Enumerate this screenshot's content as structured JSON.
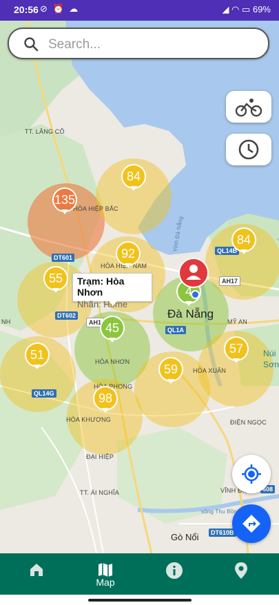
{
  "status_bar": {
    "time": "20:56",
    "battery": "69%"
  },
  "search": {
    "placeholder": "Search..."
  },
  "colors": {
    "status_bar": "#4e2fb5",
    "nav_bar": "#006f5a",
    "good_green": "#8cc63e",
    "moderate_yellow": "#f2c21c",
    "unhealthy_orange": "#ec7a42",
    "fab_blue": "#1463f6"
  },
  "stations": [
    {
      "value": "135",
      "level": "orange"
    },
    {
      "value": "84",
      "level": "yellow"
    },
    {
      "value": "92",
      "level": "yellow"
    },
    {
      "value": "55",
      "level": "yellow"
    },
    {
      "value": "84",
      "level": "yellow"
    },
    {
      "value": "4",
      "level": "green"
    },
    {
      "value": "45",
      "level": "green"
    },
    {
      "value": "51",
      "level": "yellow"
    },
    {
      "value": "59",
      "level": "yellow"
    },
    {
      "value": "57",
      "level": "yellow"
    },
    {
      "value": "98",
      "level": "yellow"
    }
  ],
  "tooltip": {
    "station": "Trạm: Hòa Nhơn",
    "label": "Nhãn: Home"
  },
  "map_labels": {
    "lang_co": "TT. LĂNG CÔ",
    "hoa_hiep_bac": "HÒA HIỆP BẮC",
    "hoa_hiep_nam": "HÒA HIỆP NAM",
    "nh": "NH",
    "hoa_nhon": "HÒA NHƠN",
    "hoa_phong": "HÒA PHONG",
    "hoa_khuong": "HÒA KHƯƠNG",
    "dai_hiep": "ĐẠI HIỆP",
    "ai_nghia": "TT. ÁI NGHĨA",
    "hoa_xuan": "HÒA XUÂN",
    "my_an": "MỸ AN",
    "dien_ngoc": "ĐIỆN NGỌC",
    "vinh_dien": "VĨNH ĐIỆ",
    "go_noi": "Gò Nổi",
    "da_nang": "Đà Nẵng",
    "nui": "Núi",
    "son": "Sơn",
    "vinh_da_nang": "Vịnh Đà Nẵng",
    "song_thu_bon": "sông Thu Bồn"
  },
  "road_tags": {
    "dt601": "DT601",
    "dt602": "DT602",
    "ql14b": "QL14B",
    "ah17": "AH17",
    "ah1": "AH1",
    "ql1a": "QL1A",
    "ql14g": "QL14G",
    "dt608": "608",
    "dt610b": "DT610B"
  },
  "nav": {
    "home_label": "",
    "map_label": "Map",
    "info_label": "",
    "location_label": ""
  }
}
